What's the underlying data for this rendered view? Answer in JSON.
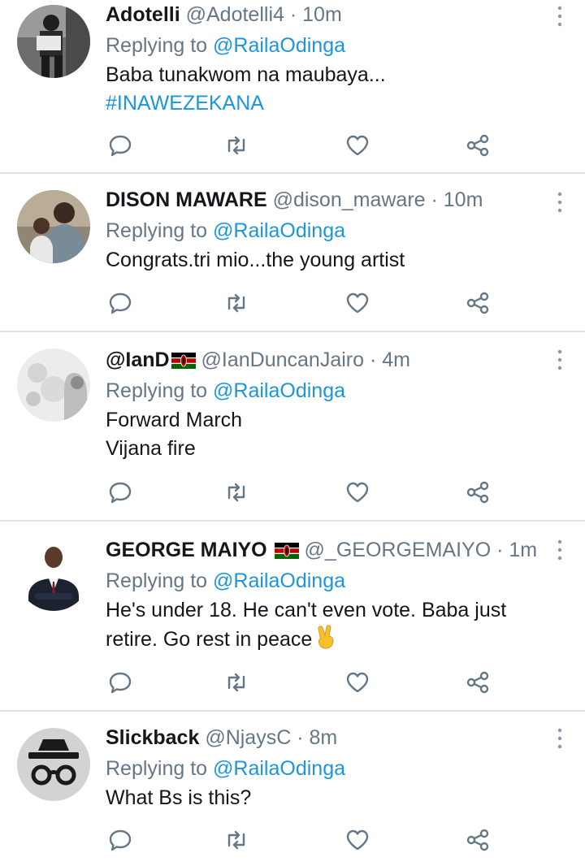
{
  "replying_prefix": "Replying to",
  "tweets": [
    {
      "display_name": "Adotelli",
      "handle": "@Adotelli4",
      "time": "· 10m",
      "reply_to": "@RailaOdinga",
      "text_lines": [
        "Baba tunakwom na maubaya..."
      ],
      "hashtag": "#INAWEZEKANA",
      "has_flag": false,
      "avatar_icon": "person-photo"
    },
    {
      "display_name": "DISON MAWARE",
      "handle": "@dison_maware",
      "time": "· 10m",
      "reply_to": "@RailaOdinga",
      "text_lines": [
        "Congrats.tri mio...the young artist"
      ],
      "has_flag": false,
      "avatar_icon": "family-photo"
    },
    {
      "display_name": "@IanD",
      "handle": "@IanDuncanJairo",
      "time": "· 4m",
      "reply_to": "@RailaOdinga",
      "text_lines": [
        "Forward March",
        "Vijana fire"
      ],
      "has_flag": true,
      "avatar_icon": "bw-portrait"
    },
    {
      "display_name": "GEORGE MAIYO",
      "handle": "@_GEORGEMAIYO",
      "time": "· 1m",
      "reply_to": "@RailaOdinga",
      "text_lines": [
        "He's under 18. He can't even vote. Baba just",
        "retire. Go rest in peace"
      ],
      "has_flag": true,
      "emoji": "victory-hand",
      "avatar_icon": "suit-portrait"
    },
    {
      "display_name": "Slickback",
      "handle": "@NjaysC",
      "time": "· 8m",
      "reply_to": "@RailaOdinga",
      "text_lines": [
        "What Bs is this?"
      ],
      "has_flag": false,
      "avatar_icon": "incognito-icon"
    }
  ],
  "colors": {
    "text": "#14171a",
    "secondary": "#657786",
    "link": "#1b95e0",
    "divider": "#dfe3e6"
  },
  "action_icons": [
    "reply-icon",
    "retweet-icon",
    "like-icon",
    "share-icon"
  ]
}
